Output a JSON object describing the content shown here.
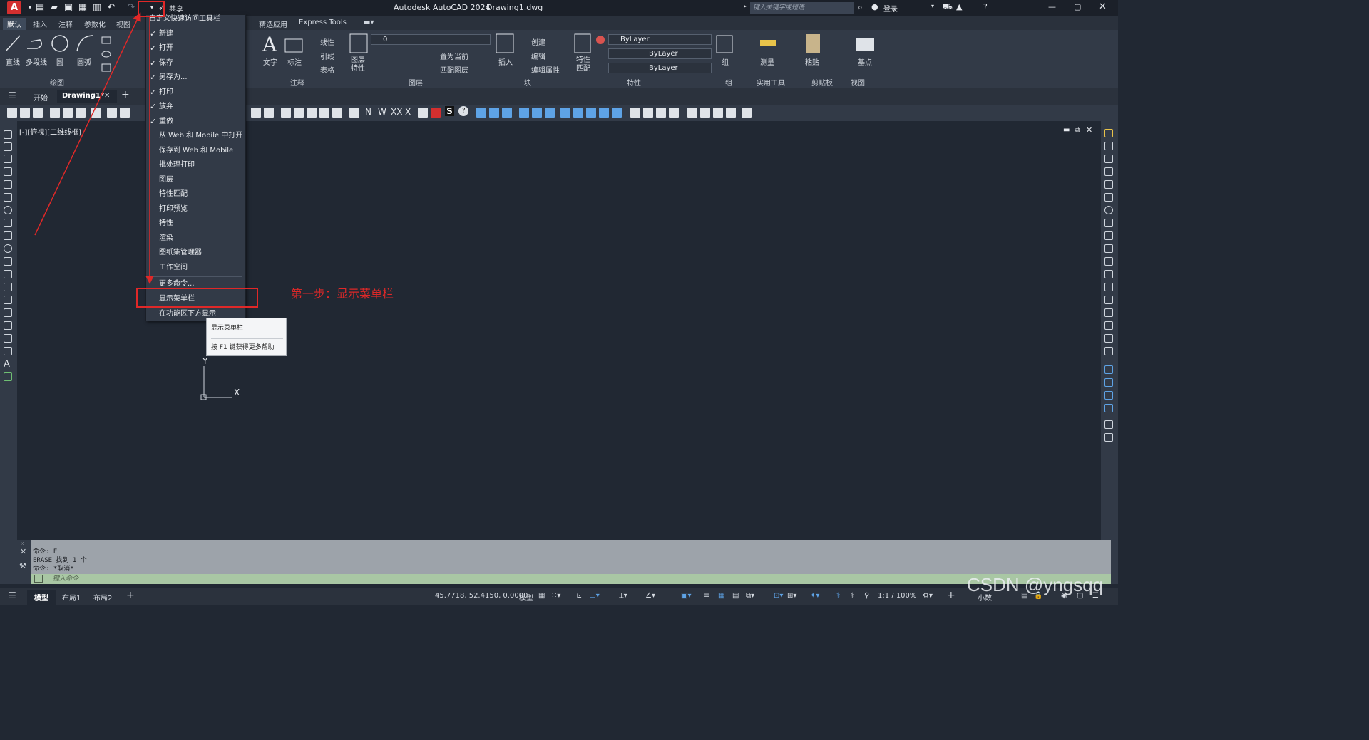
{
  "app": {
    "logo_letter": "A",
    "title": "Autodesk AutoCAD 2024",
    "document": "Drawing1.dwg",
    "share_label": "共享",
    "search_placeholder": "键入关键字或短语",
    "login_label": "登录"
  },
  "ribbon_tabs": [
    "默认",
    "插入",
    "注释",
    "参数化",
    "视图",
    "精选应用",
    "Express Tools"
  ],
  "ribbon": {
    "draw": {
      "line": "直线",
      "polyline": "多段线",
      "circle": "圆",
      "arc": "圆弧",
      "group": "绘图"
    },
    "annotation": {
      "text": "文字",
      "dimension": "标注",
      "linear": "线性",
      "leader": "引线",
      "table": "表格",
      "group": "注释"
    },
    "layers": {
      "props": "图层特性",
      "layer_value": "0",
      "set_current": "置为当前",
      "match_layer": "匹配图层",
      "group": "图层"
    },
    "block": {
      "insert": "插入",
      "create": "创建",
      "edit": "编辑",
      "edit_attr": "编辑属性",
      "group": "块"
    },
    "properties": {
      "match": "特性匹配",
      "color": "ByLayer",
      "linetype": "ByLayer",
      "lineweight": "ByLayer",
      "group": "特性"
    },
    "groups": {
      "group": "组",
      "measure": "测量",
      "utilities": "实用工具",
      "paste": "粘贴",
      "clipboard": "剪贴板",
      "base": "基点",
      "view": "视图"
    }
  },
  "doc_tabs": {
    "start": "开始",
    "drawing": "Drawing1*"
  },
  "viewport_label": "[-][俯视][二维线框]",
  "menu": {
    "header": "自定义快速访问工具栏",
    "items": [
      {
        "label": "新建",
        "checked": "✓"
      },
      {
        "label": "打开",
        "checked": "✓"
      },
      {
        "label": "保存",
        "checked": "✓"
      },
      {
        "label": "另存为...",
        "checked": "✓"
      },
      {
        "label": "打印",
        "checked": "✓"
      },
      {
        "label": "放弃",
        "checked": "✓"
      },
      {
        "label": "重做",
        "checked": "✓"
      },
      {
        "label": "从 Web 和 Mobile 中打开",
        "checked": ""
      },
      {
        "label": "保存到 Web 和 Mobile",
        "checked": ""
      },
      {
        "label": "批处理打印",
        "checked": ""
      },
      {
        "label": "图层",
        "checked": ""
      },
      {
        "label": "特性匹配",
        "checked": ""
      },
      {
        "label": "打印预览",
        "checked": ""
      },
      {
        "label": "特性",
        "checked": ""
      },
      {
        "label": "渲染",
        "checked": ""
      },
      {
        "label": "图纸集管理器",
        "checked": ""
      },
      {
        "label": "工作空间",
        "checked": ""
      }
    ],
    "more": "更多命令...",
    "show_menubar": "显示菜单栏",
    "below_ribbon": "在功能区下方显示"
  },
  "tooltip": {
    "title": "显示菜单栏",
    "help": "按 F1 键获得更多帮助"
  },
  "annotation": "第一步：显示菜单栏",
  "ucs": {
    "y": "Y",
    "x": "X"
  },
  "command_history": [
    "命令: E",
    "ERASE 找到 1 个",
    "命令: *取消*"
  ],
  "command_placeholder": "键入命令",
  "status": {
    "model": "模型",
    "layout1": "布局1",
    "layout2": "布局2",
    "coords": "45.7718, 52.4150, 0.0000",
    "model_btn": "模型",
    "scale": "1:1 / 100%",
    "units": "小数"
  },
  "watermark": "CSDN @yngsqq"
}
